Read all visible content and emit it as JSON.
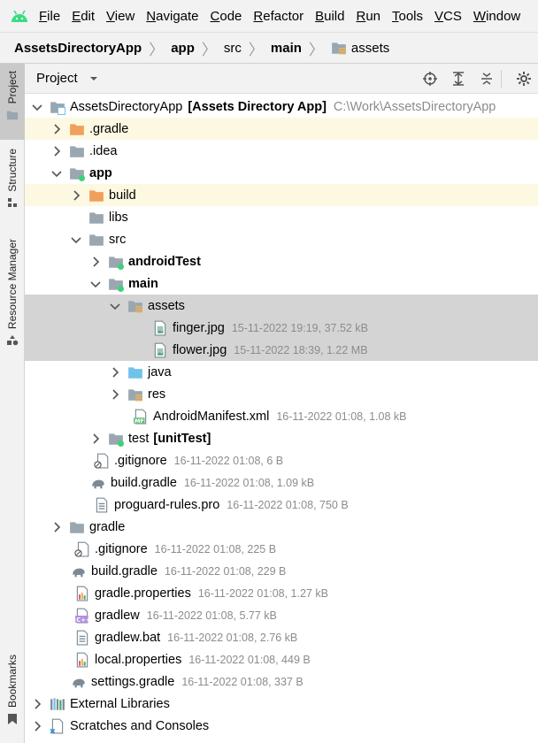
{
  "menu": [
    "File",
    "Edit",
    "View",
    "Navigate",
    "Code",
    "Refactor",
    "Build",
    "Run",
    "Tools",
    "VCS",
    "Window"
  ],
  "breadcrumb": [
    "AssetsDirectoryApp",
    "app",
    "src",
    "main",
    "assets"
  ],
  "side_tabs": {
    "project": "Project",
    "structure": "Structure",
    "resource_manager": "Resource Manager",
    "bookmarks": "Bookmarks"
  },
  "panel": {
    "title": "Project"
  },
  "tree": {
    "root": {
      "name": "AssetsDirectoryApp",
      "module": "[Assets Directory App]",
      "path": "C:\\Work\\AssetsDirectoryApp"
    },
    "gradle_dir": ".gradle",
    "idea": ".idea",
    "app": "app",
    "build": "build",
    "libs": "libs",
    "src": "src",
    "androidTest": "androidTest",
    "main": "main",
    "assets": "assets",
    "finger": {
      "name": "finger.jpg",
      "meta": "15-11-2022 19:19, 37.52 kB"
    },
    "flower": {
      "name": "flower.jpg",
      "meta": "15-11-2022 18:39, 1.22 MB"
    },
    "java": "java",
    "res": "res",
    "manifest": {
      "name": "AndroidManifest.xml",
      "meta": "16-11-2022 01:08, 1.08 kB"
    },
    "test": {
      "name": "test",
      "suffix": "[unitTest]"
    },
    "app_gitignore": {
      "name": ".gitignore",
      "meta": "16-11-2022 01:08, 6 B"
    },
    "app_build_gradle": {
      "name": "build.gradle",
      "meta": "16-11-2022 01:08, 1.09 kB"
    },
    "proguard": {
      "name": "proguard-rules.pro",
      "meta": "16-11-2022 01:08, 750 B"
    },
    "gradle": "gradle",
    "root_gitignore": {
      "name": ".gitignore",
      "meta": "16-11-2022 01:08, 225 B"
    },
    "root_build_gradle": {
      "name": "build.gradle",
      "meta": "16-11-2022 01:08, 229 B"
    },
    "gradle_properties": {
      "name": "gradle.properties",
      "meta": "16-11-2022 01:08, 1.27 kB"
    },
    "gradlew": {
      "name": "gradlew",
      "meta": "16-11-2022 01:08, 5.77 kB"
    },
    "gradlew_bat": {
      "name": "gradlew.bat",
      "meta": "16-11-2022 01:08, 2.76 kB"
    },
    "local_properties": {
      "name": "local.properties",
      "meta": "16-11-2022 01:08, 449 B"
    },
    "settings_gradle": {
      "name": "settings.gradle",
      "meta": "16-11-2022 01:08, 337 B"
    },
    "external": "External Libraries",
    "scratches": "Scratches and Consoles"
  },
  "colors": {
    "folder": "#9aa7b0",
    "excluded_folder": "#f0a05a",
    "source_folder": "#6fc3e9",
    "module_dot": "#3fd07a",
    "excluded_bg": "#fdf8e2",
    "selection": "#d4d4d4"
  }
}
